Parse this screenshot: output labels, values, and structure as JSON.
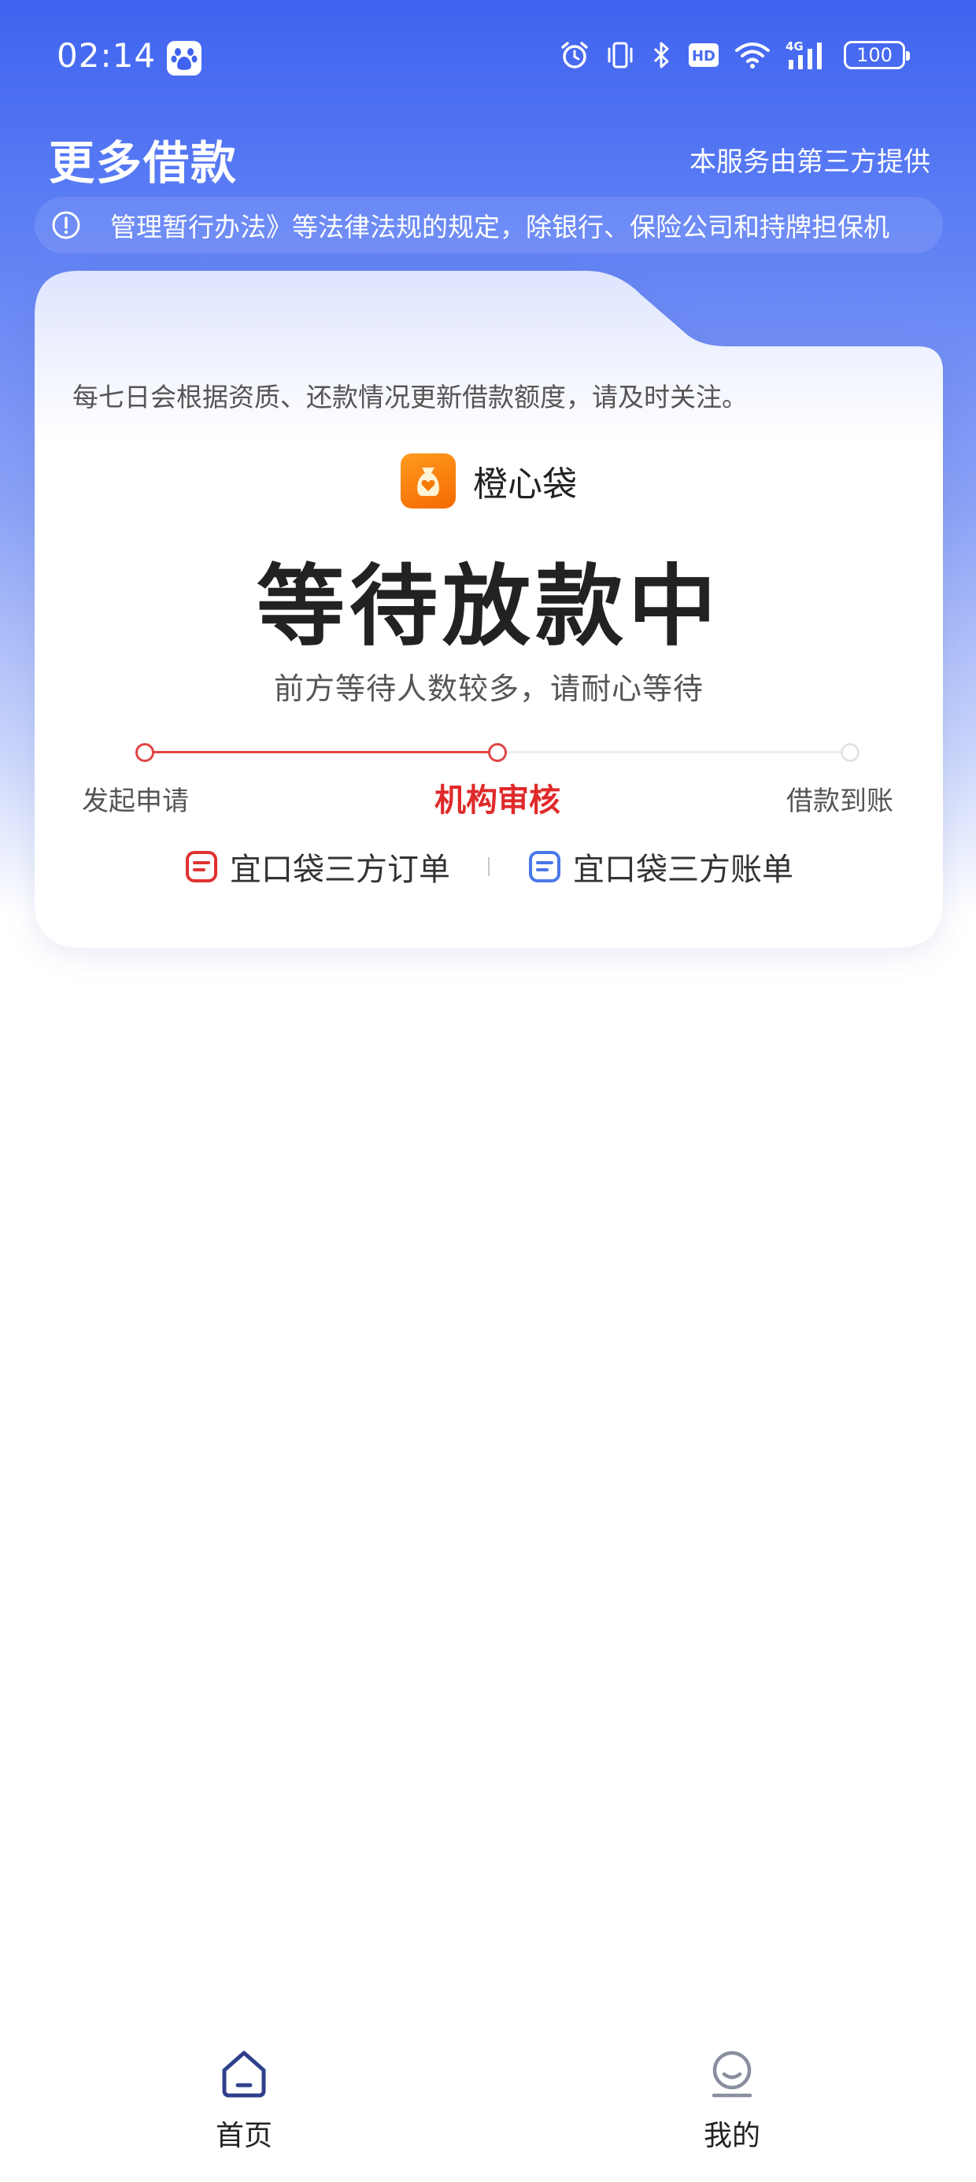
{
  "status_bar": {
    "time": "02:14",
    "network": "4G",
    "battery": "100",
    "hd": "HD",
    "icons": [
      "baidu-paw-icon",
      "alarm-icon",
      "vibrate-icon",
      "bluetooth-icon",
      "hd-icon",
      "wifi-icon",
      "signal-icon",
      "battery-icon"
    ]
  },
  "header": {
    "title": "更多借款",
    "provider_note": "本服务由第三方提供"
  },
  "notice": {
    "icon": "info-icon",
    "text": "管理暂行办法》等法律法规的规定，除银行、保险公司和持牌担保机"
  },
  "card": {
    "tip": "每七日会根据资质、还款情况更新借款额度，请及时关注。",
    "brand_name": "橙心袋",
    "status_title": "等待放款中",
    "status_subtitle": "前方等待人数较多，请耐心等待",
    "steps": [
      {
        "label": "发起申请",
        "state": "done"
      },
      {
        "label": "机构审核",
        "state": "active"
      },
      {
        "label": "借款到账",
        "state": "pending"
      }
    ],
    "links": [
      {
        "label": "宜口袋三方订单",
        "icon": "order-icon"
      },
      {
        "label": "宜口袋三方账单",
        "icon": "bill-icon"
      }
    ]
  },
  "bottom_nav": {
    "items": [
      {
        "label": "首页",
        "icon": "home-icon"
      },
      {
        "label": "我的",
        "icon": "profile-icon"
      }
    ]
  },
  "colors": {
    "brand_blue": "#3f63f0",
    "accent_red": "#e02a2a",
    "orange": "#f57a00",
    "link_blue": "#4a78e8"
  }
}
